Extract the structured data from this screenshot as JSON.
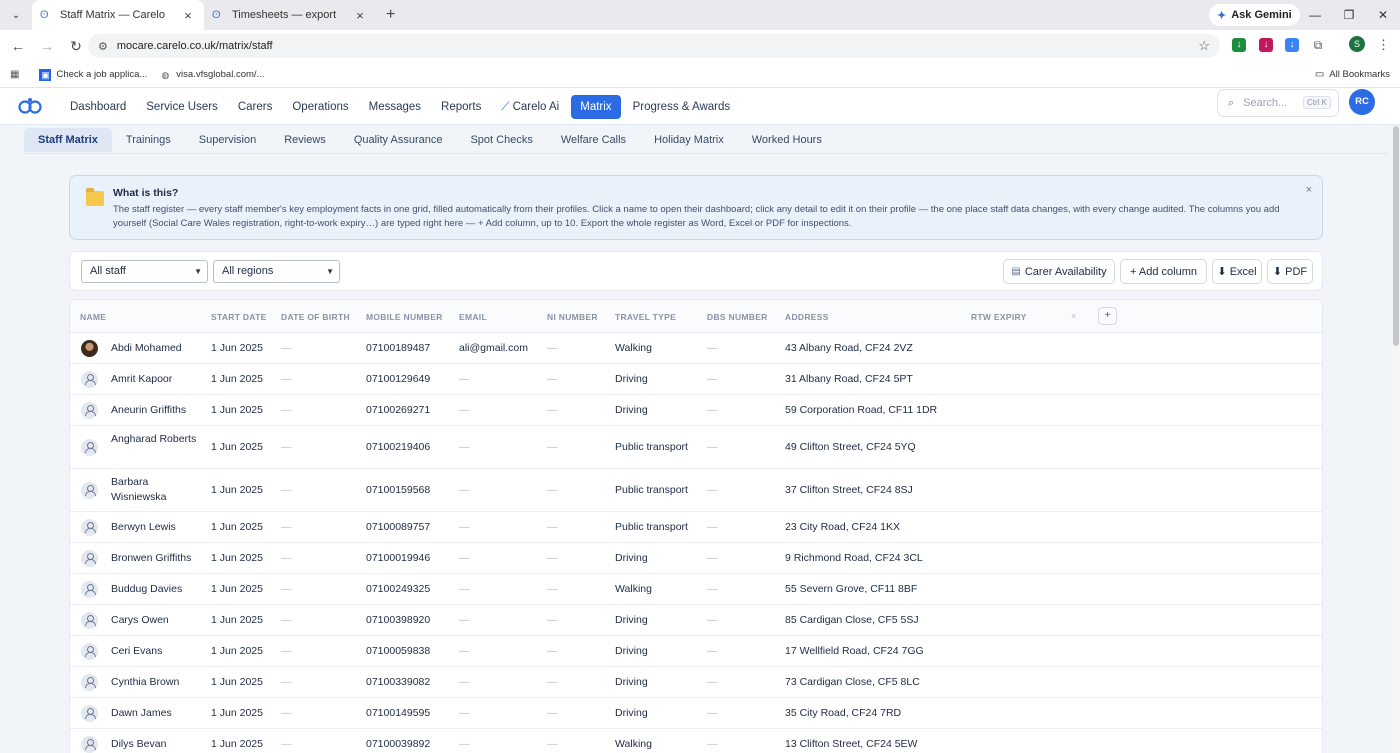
{
  "browser": {
    "tabs": [
      {
        "title": "Staff Matrix — Carelo",
        "active": true
      },
      {
        "title": "Timesheets — export",
        "active": false
      }
    ],
    "ask_gemini": "Ask Gemini",
    "url": "mocare.carelo.co.uk/matrix/staff",
    "profile_initial": "S",
    "bookmarks": [
      "Check a job applica...",
      "visa.vfsglobal.com/..."
    ],
    "all_bookmarks": "All Bookmarks"
  },
  "app": {
    "nav": [
      "Dashboard",
      "Service Users",
      "Carers",
      "Operations",
      "Messages",
      "Reports",
      "Carelo Ai",
      "Matrix",
      "Progress & Awards"
    ],
    "active_nav": "Matrix",
    "search_placeholder": "Search...",
    "search_shortcut": "Ctrl K",
    "user_initials": "RC",
    "accent": "#2b6be3"
  },
  "subtabs": [
    "Staff Matrix",
    "Trainings",
    "Supervision",
    "Reviews",
    "Quality Assurance",
    "Spot Checks",
    "Welfare Calls",
    "Holiday Matrix",
    "Worked Hours"
  ],
  "info": {
    "title": "What is this?",
    "text": "The staff register — every staff member's key employment facts in one grid, filled automatically from their profiles. Click a name to open their dashboard; click any detail to edit it on their profile — the one place staff data changes, with every change audited. The columns you add yourself (Social Care Wales registration, right-to-work expiry…) are typed right here — + Add column, up to 10. Export the whole register as Word, Excel or PDF for inspections."
  },
  "filters": {
    "staff": "All staff",
    "regions": "All regions",
    "buttons": [
      "Carer Availability",
      "+ Add column",
      "⬇ Excel",
      "⬇ PDF"
    ]
  },
  "table": {
    "columns": [
      "NAME",
      "START DATE",
      "DATE OF BIRTH",
      "MOBILE NUMBER",
      "EMAIL",
      "NI NUMBER",
      "TRAVEL TYPE",
      "DBS NUMBER",
      "ADDRESS",
      "RTW EXPIRY"
    ],
    "dash": "—",
    "rows": [
      {
        "name": "Abdi Mohamed",
        "start": "1 Jun 2025",
        "mobile": "07100189487",
        "email": "ali@gmail.com",
        "travel": "Walking",
        "address": "43 Albany Road, CF24 2VZ"
      },
      {
        "name": "Amrit Kapoor",
        "start": "1 Jun 2025",
        "mobile": "07100129649",
        "email": "",
        "travel": "Driving",
        "address": "31 Albany Road, CF24 5PT"
      },
      {
        "name": "Aneurin Griffiths",
        "start": "1 Jun 2025",
        "mobile": "07100269271",
        "email": "",
        "travel": "Driving",
        "address": "59 Corporation Road, CF11 1DR"
      },
      {
        "name": "Angharad Roberts",
        "start": "1 Jun 2025",
        "mobile": "07100219406",
        "email": "",
        "travel": "Public transport",
        "address": "49 Clifton Street, CF24 5YQ"
      },
      {
        "name": "Barbara Wisniewska",
        "start": "1 Jun 2025",
        "mobile": "07100159568",
        "email": "",
        "travel": "Public transport",
        "address": "37 Clifton Street, CF24 8SJ"
      },
      {
        "name": "Berwyn Lewis",
        "start": "1 Jun 2025",
        "mobile": "07100089757",
        "email": "",
        "travel": "Public transport",
        "address": "23 City Road, CF24 1KX"
      },
      {
        "name": "Bronwen Griffiths",
        "start": "1 Jun 2025",
        "mobile": "07100019946",
        "email": "",
        "travel": "Driving",
        "address": "9 Richmond Road, CF24 3CL"
      },
      {
        "name": "Buddug Davies",
        "start": "1 Jun 2025",
        "mobile": "07100249325",
        "email": "",
        "travel": "Walking",
        "address": "55 Severn Grove, CF11 8BF"
      },
      {
        "name": "Carys Owen",
        "start": "1 Jun 2025",
        "mobile": "07100398920",
        "email": "",
        "travel": "Driving",
        "address": "85 Cardigan Close, CF5 5SJ"
      },
      {
        "name": "Ceri Evans",
        "start": "1 Jun 2025",
        "mobile": "07100059838",
        "email": "",
        "travel": "Driving",
        "address": "17 Wellfield Road, CF24 7GG"
      },
      {
        "name": "Cynthia Brown",
        "start": "1 Jun 2025",
        "mobile": "07100339082",
        "email": "",
        "travel": "Driving",
        "address": "73 Cardigan Close, CF5 8LC"
      },
      {
        "name": "Dawn James",
        "start": "1 Jun 2025",
        "mobile": "07100149595",
        "email": "",
        "travel": "Driving",
        "address": "35 City Road, CF24 7RD"
      },
      {
        "name": "Dilys Bevan",
        "start": "1 Jun 2025",
        "mobile": "07100039892",
        "email": "",
        "travel": "Walking",
        "address": "13 Clifton Street, CF24 5EW"
      }
    ]
  }
}
